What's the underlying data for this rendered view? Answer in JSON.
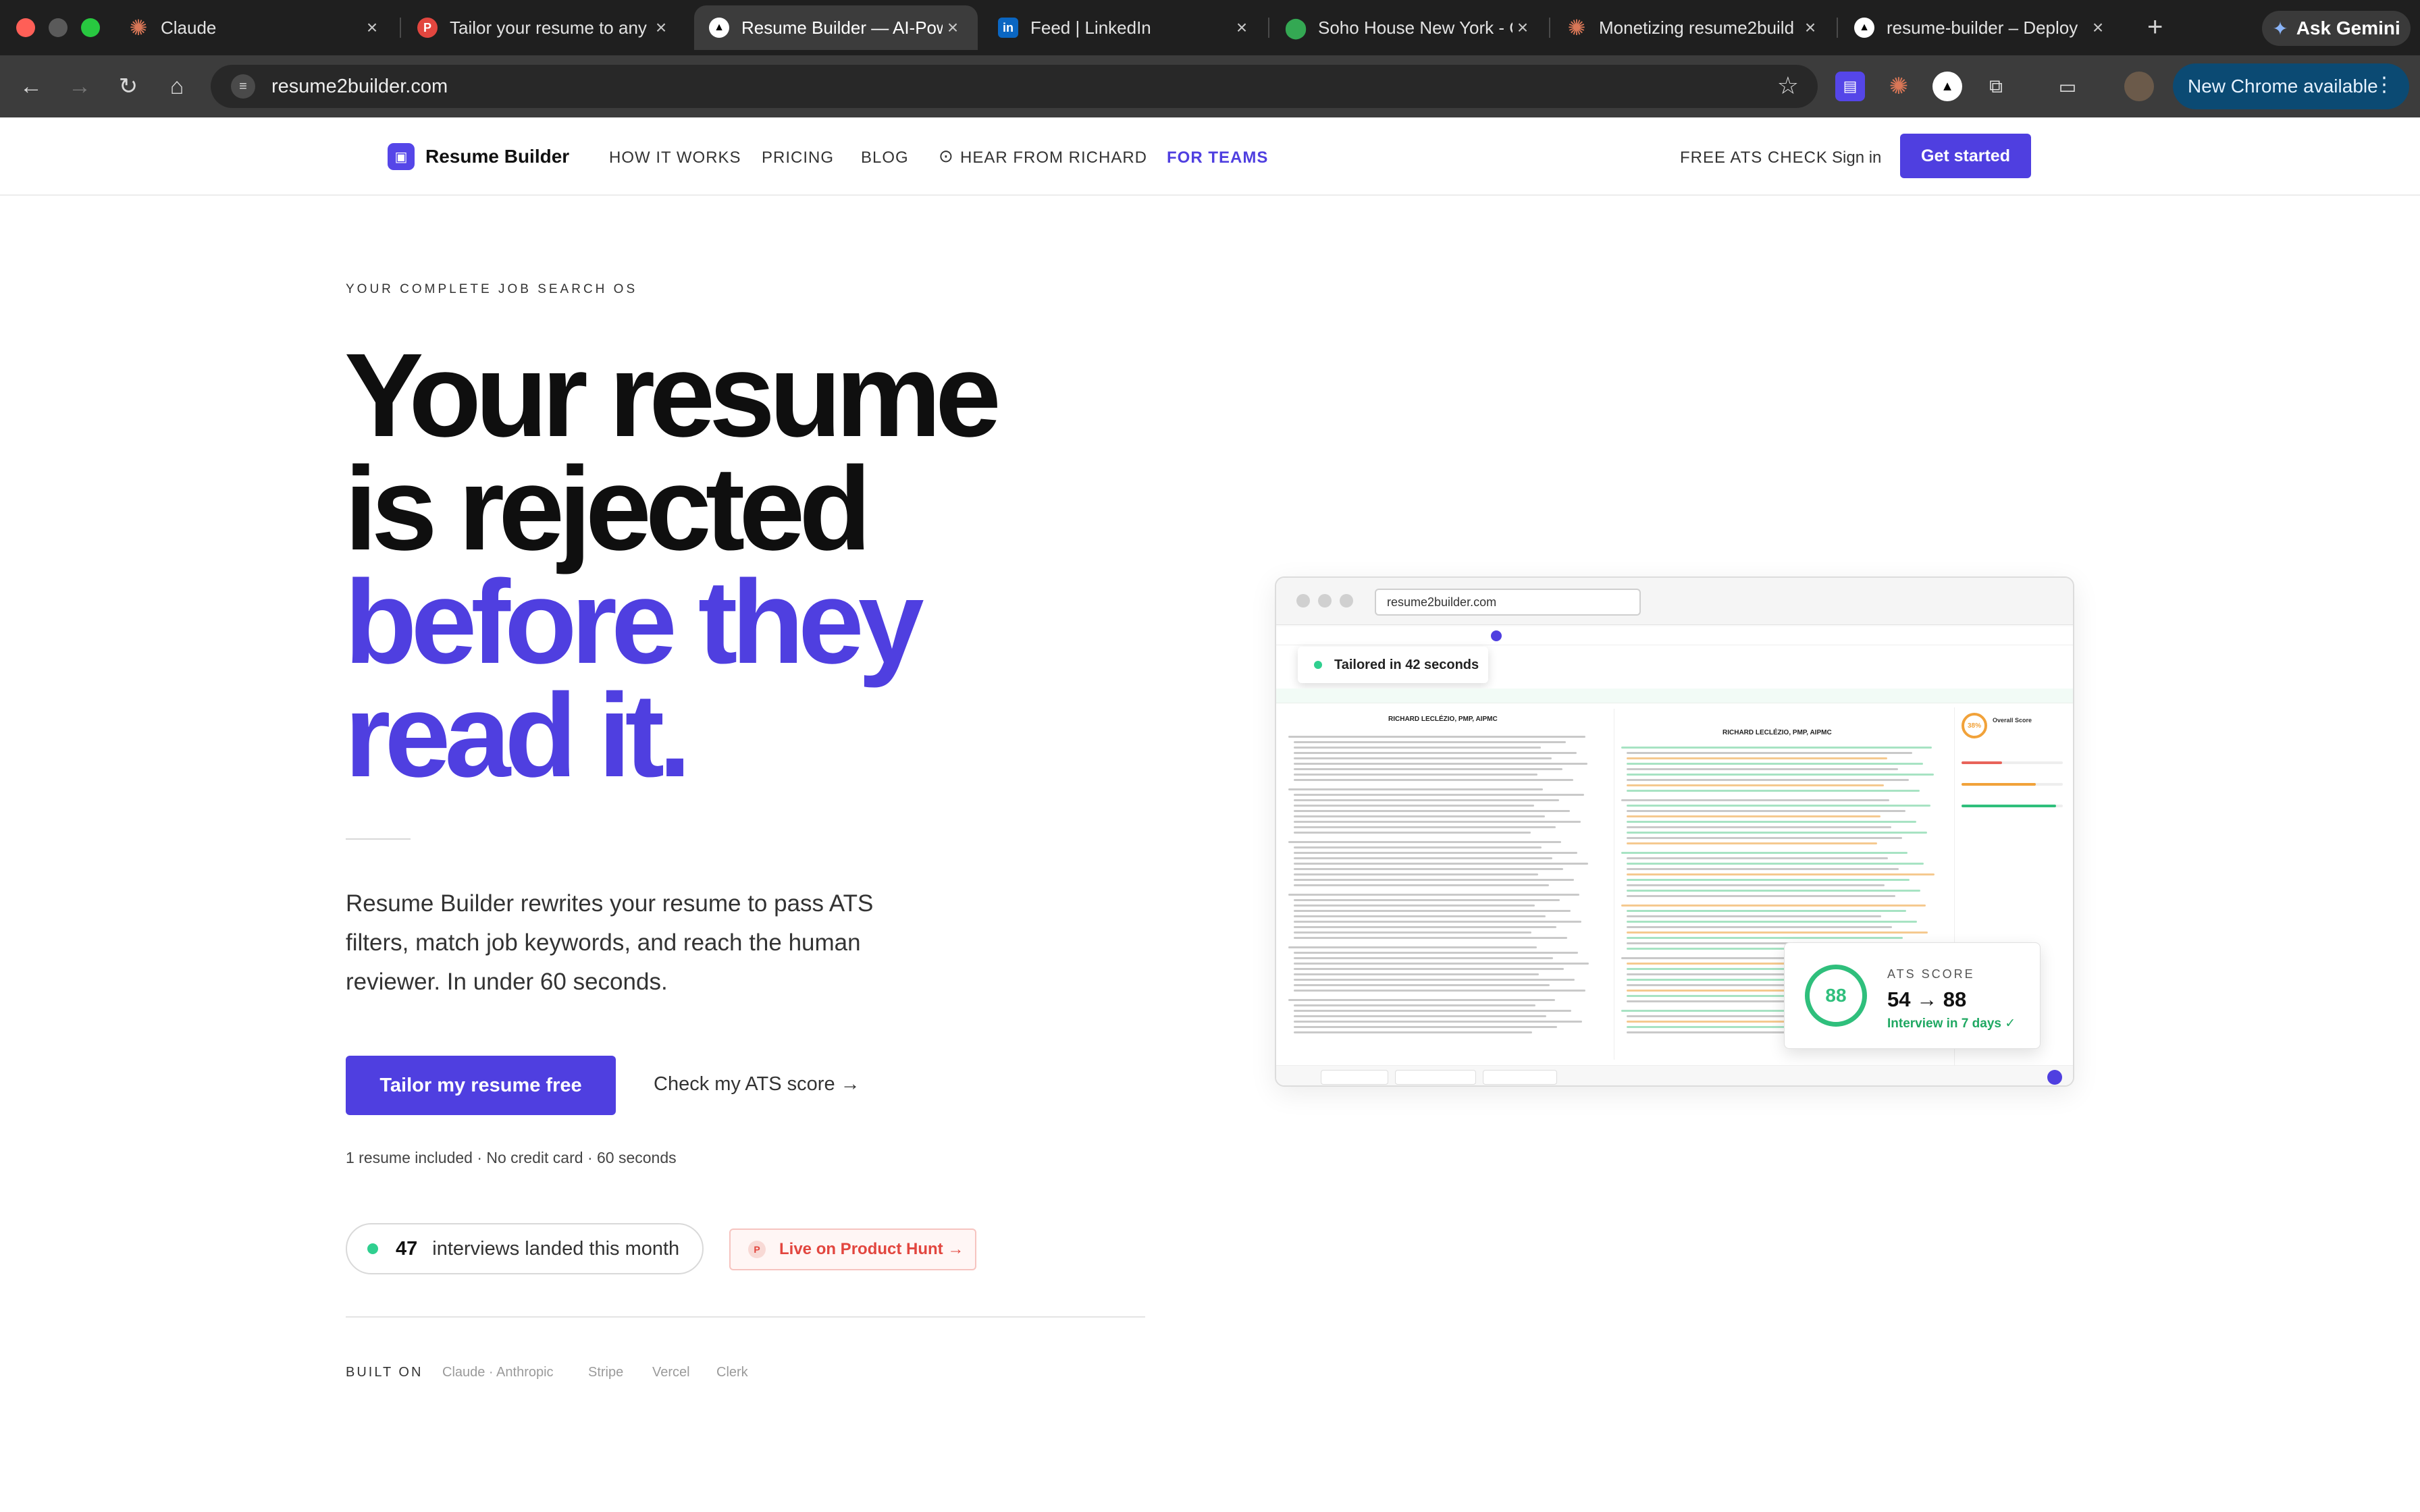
{
  "browser": {
    "tabs": [
      {
        "title": "Claude",
        "favicon": "claude-burst-icon",
        "color": "#d97757"
      },
      {
        "title": "Tailor your resume to any",
        "favicon": "p-badge-icon",
        "color": "#e2463f"
      },
      {
        "title": "Resume Builder — AI-Pow",
        "favicon": "triangle-icon",
        "color": "#000000",
        "active": true
      },
      {
        "title": "Feed | LinkedIn",
        "favicon": "linkedin-icon",
        "color": "#0a66c2"
      },
      {
        "title": "Soho House New York - C",
        "favicon": "maps-pin-icon",
        "color": "#34a853"
      },
      {
        "title": "Monetizing resume2build",
        "favicon": "claude-burst-icon",
        "color": "#d97757"
      },
      {
        "title": "resume-builder – Deploy",
        "favicon": "triangle-icon",
        "color": "#000000"
      }
    ],
    "ask_gemini": "Ask Gemini",
    "url": "resume2builder.com",
    "new_chrome": "New Chrome available"
  },
  "site": {
    "brand": "Resume Builder",
    "nav": [
      "HOW IT WORKS",
      "PRICING",
      "BLOG",
      "HEAR FROM RICHARD",
      "FOR TEAMS"
    ],
    "free_ats": "FREE ATS CHECK",
    "sign_in": "Sign in",
    "get_started": "Get started",
    "accent": "#4f3fe0"
  },
  "hero": {
    "eyebrow": "YOUR COMPLETE JOB SEARCH OS",
    "headline_l1": "Your resume",
    "headline_l2": "is rejected",
    "headline_l3": "before they",
    "headline_l4": "read it.",
    "subcopy": "Resume Builder rewrites your resume to pass ATS filters, match job keywords, and reach the human reviewer. In under 60 seconds.",
    "cta_primary": "Tailor my resume free",
    "cta_secondary": "Check my ATS score →",
    "fine_print": "1 resume included · No credit card · 60 seconds",
    "interviews_count": "47",
    "interviews_text": "interviews landed this month",
    "product_hunt": "Live on Product Hunt →",
    "built_on_label": "BUILT ON",
    "built_on": [
      "Claude · Anthropic",
      "Stripe",
      "Vercel",
      "Clerk"
    ]
  },
  "mockup": {
    "url": "resume2builder.com",
    "tailored": "Tailored in 42 seconds",
    "resume_name": "RICHARD LECLÉZIO, PMP, AIPMC",
    "ats_label": "ATS SCORE",
    "ats_score": "88",
    "ats_change": "54 → 88",
    "ats_sub": "Interview in 7 days ✓",
    "overall_score": "Overall Score",
    "ring_small": "38%"
  }
}
